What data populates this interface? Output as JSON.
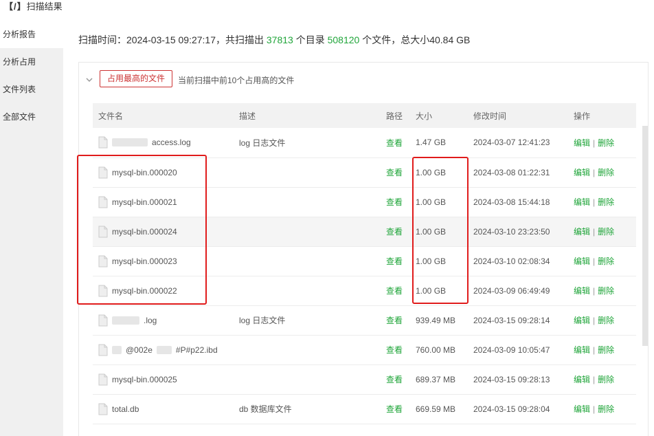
{
  "title": {
    "bracket": "【/】",
    "text": "扫描结果"
  },
  "sidebar": {
    "items": [
      {
        "label": "分析报告",
        "active": true
      },
      {
        "label": "分析占用"
      },
      {
        "label": "文件列表"
      },
      {
        "label": "全部文件"
      }
    ]
  },
  "summary": {
    "prefix": "扫描时间：2024-03-15 09:27:17，共扫描出 ",
    "dir_count": "37813",
    "mid": " 个目录 ",
    "file_count": "508120",
    "suffix": " 个文件，总大小40.84 GB"
  },
  "section": {
    "button": "占用最高的文件",
    "note": "当前扫描中前10个占用高的文件"
  },
  "table": {
    "headers": {
      "name": "文件名",
      "desc": "描述",
      "path": "路径",
      "size": "大小",
      "mtime": "修改时间",
      "ops": "操作"
    },
    "view_label": "查看",
    "edit_label": "编辑",
    "delete_label": "删除",
    "separator": "|",
    "rows": [
      {
        "name": "access.log",
        "desc": "log 日志文件",
        "size": "1.47 GB",
        "mtime": "2024-03-07 12:41:23"
      },
      {
        "name": "mysql-bin.000020",
        "desc": "",
        "size": "1.00 GB",
        "mtime": "2024-03-08 01:22:31"
      },
      {
        "name": "mysql-bin.000021",
        "desc": "",
        "size": "1.00 GB",
        "mtime": "2024-03-08 15:44:18"
      },
      {
        "name": "mysql-bin.000024",
        "desc": "",
        "size": "1.00 GB",
        "mtime": "2024-03-10 23:23:50"
      },
      {
        "name": "mysql-bin.000023",
        "desc": "",
        "size": "1.00 GB",
        "mtime": "2024-03-10 02:08:34"
      },
      {
        "name": "mysql-bin.000022",
        "desc": "",
        "size": "1.00 GB",
        "mtime": "2024-03-09 06:49:49"
      },
      {
        "name": ".log",
        "desc": "log 日志文件",
        "size": "939.49 MB",
        "mtime": "2024-03-15 09:28:14"
      },
      {
        "name": "@002e",
        "name_suffix": "#P#p22.ibd",
        "desc": "",
        "size": "760.00 MB",
        "mtime": "2024-03-09 10:05:47"
      },
      {
        "name": "mysql-bin.000025",
        "desc": "",
        "size": "689.37 MB",
        "mtime": "2024-03-15 09:28:13"
      },
      {
        "name": "total.db",
        "desc": "db 数据库文件",
        "size": "669.59 MB",
        "mtime": "2024-03-15 09:28:04"
      }
    ]
  }
}
